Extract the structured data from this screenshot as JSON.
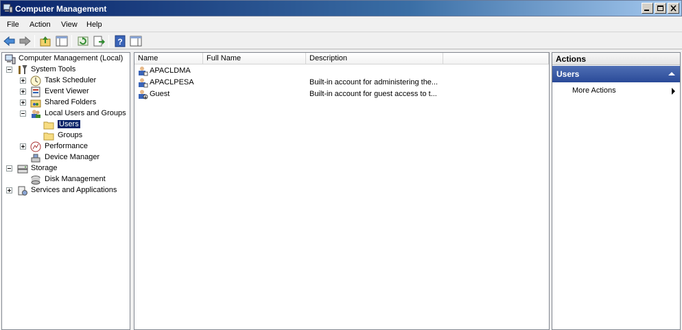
{
  "window": {
    "title": "Computer Management"
  },
  "menu": [
    "File",
    "Action",
    "View",
    "Help"
  ],
  "tree": {
    "root": "Computer Management (Local)",
    "system_tools": "System Tools",
    "task_scheduler": "Task Scheduler",
    "event_viewer": "Event Viewer",
    "shared_folders": "Shared Folders",
    "local_users_groups": "Local Users and Groups",
    "users": "Users",
    "groups": "Groups",
    "performance": "Performance",
    "device_manager": "Device Manager",
    "storage": "Storage",
    "disk_management": "Disk Management",
    "services_apps": "Services and Applications"
  },
  "list": {
    "columns": [
      "Name",
      "Full Name",
      "Description"
    ],
    "rows": [
      {
        "name": "APACLDMA",
        "full_name": "",
        "description": ""
      },
      {
        "name": "APACLPESA",
        "full_name": "",
        "description": "Built-in account for administering the..."
      },
      {
        "name": "Guest",
        "full_name": "",
        "description": "Built-in account for guest access to t..."
      }
    ]
  },
  "actions": {
    "title": "Actions",
    "group": "Users",
    "more_actions": "More Actions"
  },
  "colors": {
    "title_bar": "#0a246a",
    "selection": "#0a246a",
    "actions_group": "#2a4a98"
  }
}
